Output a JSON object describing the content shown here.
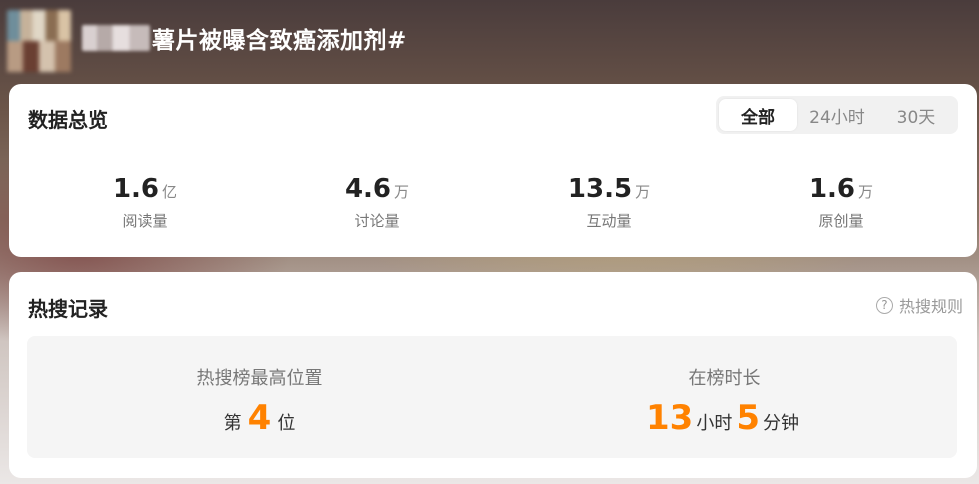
{
  "header": {
    "title": "薯片被曝含致癌添加剂#"
  },
  "overview": {
    "title": "数据总览",
    "tabs": [
      {
        "label": "全部",
        "active": true
      },
      {
        "label": "24小时",
        "active": false
      },
      {
        "label": "30天",
        "active": false
      }
    ],
    "stats": [
      {
        "value": "1.6",
        "unit": "亿",
        "label": "阅读量"
      },
      {
        "value": "4.6",
        "unit": "万",
        "label": "讨论量"
      },
      {
        "value": "13.5",
        "unit": "万",
        "label": "互动量"
      },
      {
        "value": "1.6",
        "unit": "万",
        "label": "原创量"
      }
    ]
  },
  "hot_search": {
    "title": "热搜记录",
    "rules_label": "热搜规则",
    "rules_icon": "question-circle-icon",
    "highest": {
      "label": "热搜榜最高位置",
      "prefix": "第",
      "value": "4",
      "suffix": "位"
    },
    "duration": {
      "label": "在榜时长",
      "hours": "13",
      "hours_unit": "小时",
      "minutes": "5",
      "minutes_unit": "分钟"
    },
    "accent_color": "#ff8200"
  }
}
